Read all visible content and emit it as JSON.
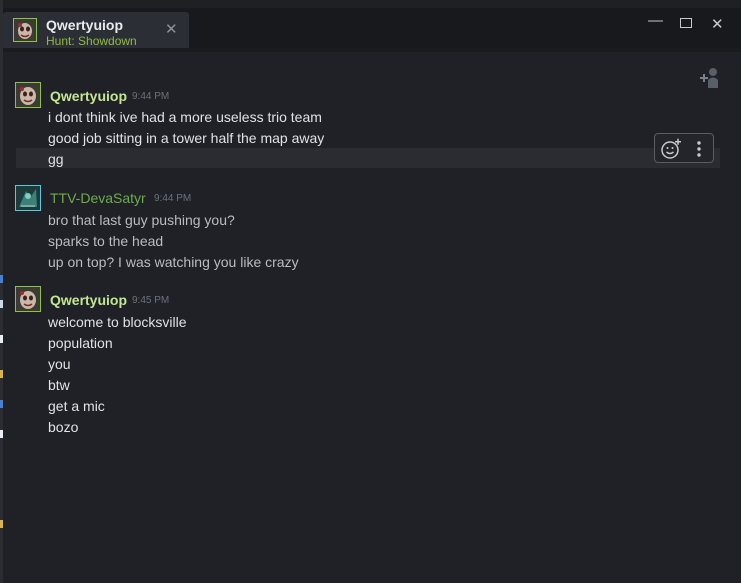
{
  "tab": {
    "name": "Qwertyuiop",
    "game": "Hunt: Showdown"
  },
  "window_controls": {
    "minimize_icon": "minimize-icon",
    "maximize_icon": "maximize-icon",
    "close_icon": "close-icon"
  },
  "icons": {
    "add_friend": "add-person-icon",
    "emoji_react": "emoji-add-icon",
    "more": "kebab-menu-icon"
  },
  "colors": {
    "background": "#1f2126",
    "online_green": "#90ba3c",
    "sender_name": "#c4e693",
    "ttv_sender": "#6dad4c"
  },
  "messages": [
    {
      "sender": "Qwertyuiop",
      "time": "9:44 PM",
      "lines": [
        "i dont think ive had a more useless trio team",
        "good job sitting in a tower half the map away",
        "gg"
      ]
    },
    {
      "sender": "TTV-DevaSatyr",
      "time": "9:44 PM",
      "lines": [
        "bro that last guy pushing you?",
        "sparks to the head",
        "up on top? I was watching you like crazy"
      ]
    },
    {
      "sender": "Qwertyuiop",
      "time": "9:45 PM",
      "lines": [
        "welcome to blocksville",
        "population",
        "you",
        "btw",
        "get a mic",
        "bozo"
      ]
    }
  ]
}
